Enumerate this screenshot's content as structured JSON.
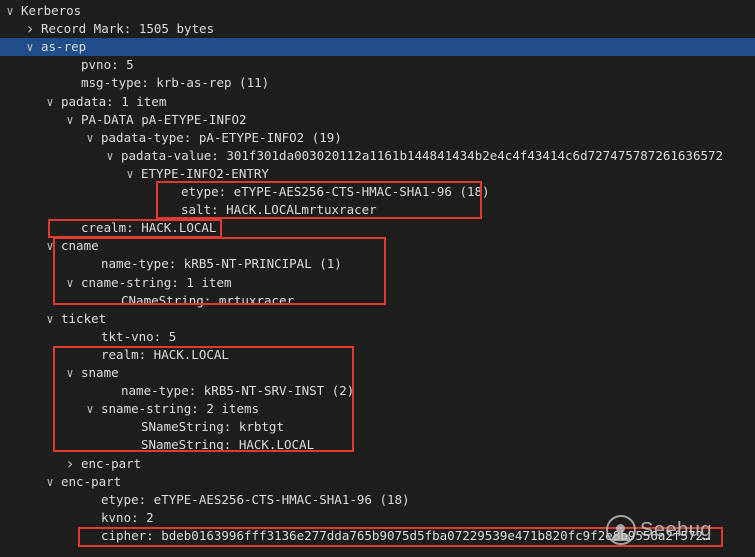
{
  "tree": [
    {
      "text": "Kerberos",
      "indent": 0,
      "toggle": "down"
    },
    {
      "text": "Record Mark: 1505 bytes",
      "indent": 1,
      "toggle": "right"
    },
    {
      "text": "as-rep",
      "indent": 1,
      "toggle": "down",
      "selected": true
    },
    {
      "text": "pvno: 5",
      "indent": 3,
      "toggle": null
    },
    {
      "text": "msg-type: krb-as-rep (11)",
      "indent": 3,
      "toggle": null
    },
    {
      "text": "padata: 1 item",
      "indent": 2,
      "toggle": "down"
    },
    {
      "text": "PA-DATA pA-ETYPE-INFO2",
      "indent": 3,
      "toggle": "down"
    },
    {
      "text": "padata-type: pA-ETYPE-INFO2 (19)",
      "indent": 4,
      "toggle": "down"
    },
    {
      "text": "padata-value: 301f301da003020112a1161b144841434b2e4c4f43414c6d727475787261636572",
      "indent": 5,
      "toggle": "down"
    },
    {
      "text": "ETYPE-INFO2-ENTRY",
      "indent": 6,
      "toggle": "down"
    },
    {
      "text": "etype: eTYPE-AES256-CTS-HMAC-SHA1-96 (18)",
      "indent": 8,
      "toggle": null
    },
    {
      "text": "salt: HACK.LOCALmrtuxracer",
      "indent": 8,
      "toggle": null
    },
    {
      "text": "crealm: HACK.LOCAL",
      "indent": 3,
      "toggle": null
    },
    {
      "text": "cname",
      "indent": 2,
      "toggle": "down"
    },
    {
      "text": "name-type: kRB5-NT-PRINCIPAL (1)",
      "indent": 4,
      "toggle": null
    },
    {
      "text": "cname-string: 1 item",
      "indent": 3,
      "toggle": "down"
    },
    {
      "text": "CNameString: mrtuxracer",
      "indent": 5,
      "toggle": null
    },
    {
      "text": "ticket",
      "indent": 2,
      "toggle": "down"
    },
    {
      "text": "tkt-vno: 5",
      "indent": 4,
      "toggle": null
    },
    {
      "text": "realm: HACK.LOCAL",
      "indent": 4,
      "toggle": null
    },
    {
      "text": "sname",
      "indent": 3,
      "toggle": "down"
    },
    {
      "text": "name-type: kRB5-NT-SRV-INST (2)",
      "indent": 5,
      "toggle": null
    },
    {
      "text": "sname-string: 2 items",
      "indent": 4,
      "toggle": "down"
    },
    {
      "text": "SNameString: krbtgt",
      "indent": 6,
      "toggle": null
    },
    {
      "text": "SNameString: HACK.LOCAL",
      "indent": 6,
      "toggle": null
    },
    {
      "text": "enc-part",
      "indent": 3,
      "toggle": "right"
    },
    {
      "text": "enc-part",
      "indent": 2,
      "toggle": "down"
    },
    {
      "text": "etype: eTYPE-AES256-CTS-HMAC-SHA1-96 (18)",
      "indent": 4,
      "toggle": null
    },
    {
      "text": "kvno: 2",
      "indent": 4,
      "toggle": null
    },
    {
      "text": "cipher: bdeb0163996fff3136e277dda765b9075d5fba07229539e471b820fc9f2e8b9556a2f572…",
      "indent": 4,
      "toggle": null
    }
  ],
  "watermark": {
    "text": "Seebug",
    "icon": "seebug-logo-icon"
  },
  "colors": {
    "background": "#1e1e1e",
    "selection": "#1f4e8a",
    "highlight": "#e03a31",
    "text": "#dcdcdc"
  }
}
